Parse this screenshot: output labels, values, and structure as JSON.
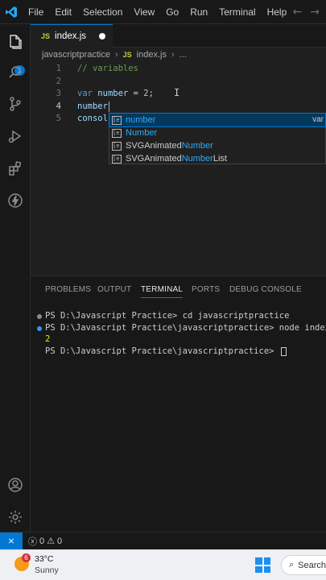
{
  "titlebar": {
    "menu": [
      "File",
      "Edit",
      "Selection",
      "View",
      "Go",
      "Run",
      "Terminal",
      "Help"
    ]
  },
  "tab": {
    "badge": "JS",
    "filename": "index.js"
  },
  "breadcrumb": {
    "folder": "javascriptpractice",
    "badge": "JS",
    "file": "index.js",
    "more": "..."
  },
  "editor": {
    "lines": [
      {
        "num": "1",
        "comment": "// variables"
      },
      {
        "num": "2"
      },
      {
        "num": "3",
        "kw": "var",
        "name": "number",
        "op": " = ",
        "value": "2",
        "end": ";"
      },
      {
        "num": "4",
        "text": "number"
      },
      {
        "num": "5",
        "text": "consol"
      }
    ]
  },
  "suggest": {
    "items": [
      {
        "match": "number",
        "rest": "",
        "prefix": "",
        "detail": "var"
      },
      {
        "match": "Number",
        "rest": "",
        "prefix": ""
      },
      {
        "prefix": "SVGAnimated",
        "match": "Number",
        "rest": ""
      },
      {
        "prefix": "SVGAnimated",
        "match": "Number",
        "rest": "List"
      }
    ]
  },
  "panel": {
    "tabs": [
      "PROBLEMS",
      "OUTPUT",
      "TERMINAL",
      "PORTS",
      "DEBUG CONSOLE"
    ],
    "terminal": [
      "PS D:\\Javascript Practice> cd javascriptpractice",
      "PS D:\\Javascript Practice\\javascriptpractice> node index.js",
      "2",
      "PS D:\\Javascript Practice\\javascriptpractice> "
    ]
  },
  "statusbar": {
    "errors": "0",
    "warnings": "0"
  },
  "taskbar": {
    "weather_badge": "6",
    "temperature": "33°C",
    "condition": "Sunny",
    "search": "Search"
  },
  "colors": {
    "accent": "#0078d4",
    "keyword": "#569cd6",
    "variable": "#9cdcfe",
    "number": "#b5cea8",
    "comment": "#6a9955"
  }
}
